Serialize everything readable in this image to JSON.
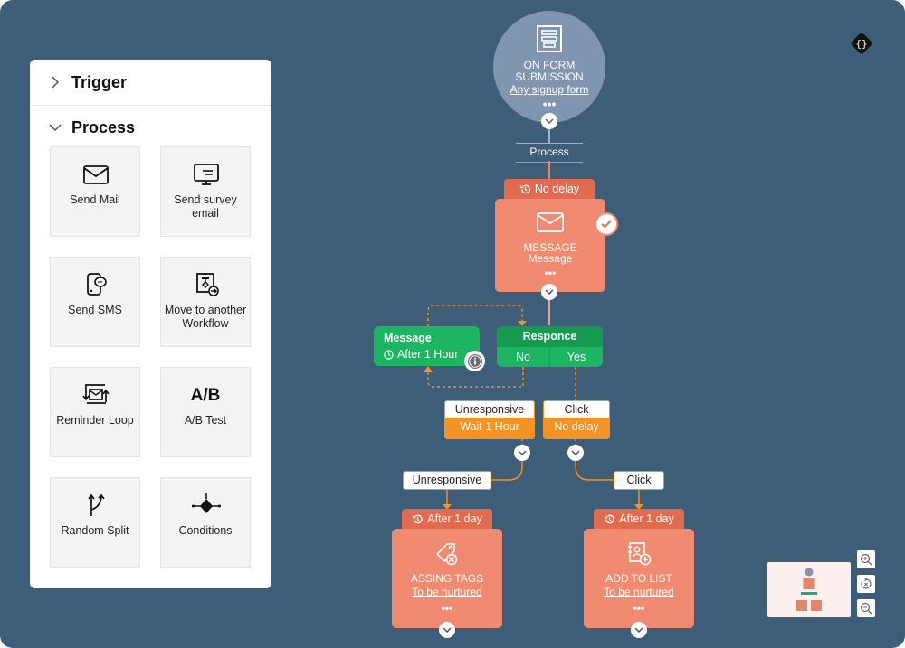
{
  "sidebar": {
    "sections": [
      {
        "label": "Trigger",
        "expanded": false
      },
      {
        "label": "Process",
        "expanded": true
      }
    ],
    "tiles": [
      {
        "label": "Send Mail",
        "icon": "envelope-icon"
      },
      {
        "label": "Send survey email",
        "icon": "monitor-survey-icon"
      },
      {
        "label": "Send SMS",
        "icon": "phone-chat-icon"
      },
      {
        "label": "Move to another Workflow",
        "icon": "workflow-move-icon"
      },
      {
        "label": "Reminder Loop",
        "icon": "reminder-loop-icon"
      },
      {
        "label": "A/B Test",
        "icon": "ab-test-icon",
        "glyph": "A/B"
      },
      {
        "label": "Random Split",
        "icon": "random-split-icon"
      },
      {
        "label": "Conditions",
        "icon": "conditions-diamond-icon"
      }
    ]
  },
  "flow": {
    "trigger": {
      "title": "ON FORM SUBMISSION",
      "subtitle": "Any signup form",
      "more": "•••"
    },
    "process_label": "Process",
    "message_step": {
      "delay": "No delay",
      "title": "MESSAGE",
      "subtitle": "Message",
      "more": "•••",
      "status": "completed"
    },
    "message_wait": {
      "title": "Message",
      "wait": "After 1 Hour"
    },
    "response": {
      "title": "Responce",
      "no": "No",
      "yes": "Yes"
    },
    "branch_unresponsive": {
      "condition": "Unresponsive",
      "delay": "Wait 1 Hour",
      "tag": "Unresponsive"
    },
    "branch_click": {
      "condition": "Click",
      "delay": "No delay",
      "tag": "Click"
    },
    "assign_tags": {
      "delay": "After 1 day",
      "title": "ASSING TAGS",
      "subtitle": "To be nurtured",
      "more": "•••"
    },
    "add_to_list": {
      "delay": "After 1 day",
      "title": "ADD TO LIST",
      "subtitle": "To be nurtured",
      "more": "•••"
    }
  },
  "colors": {
    "canvas": "#3d5d79",
    "action_card": "#f08a70",
    "delay_tab": "#e06b50",
    "green_node": "#1db462",
    "orange_branch": "#f39225",
    "trigger_node": "#8096b0"
  }
}
